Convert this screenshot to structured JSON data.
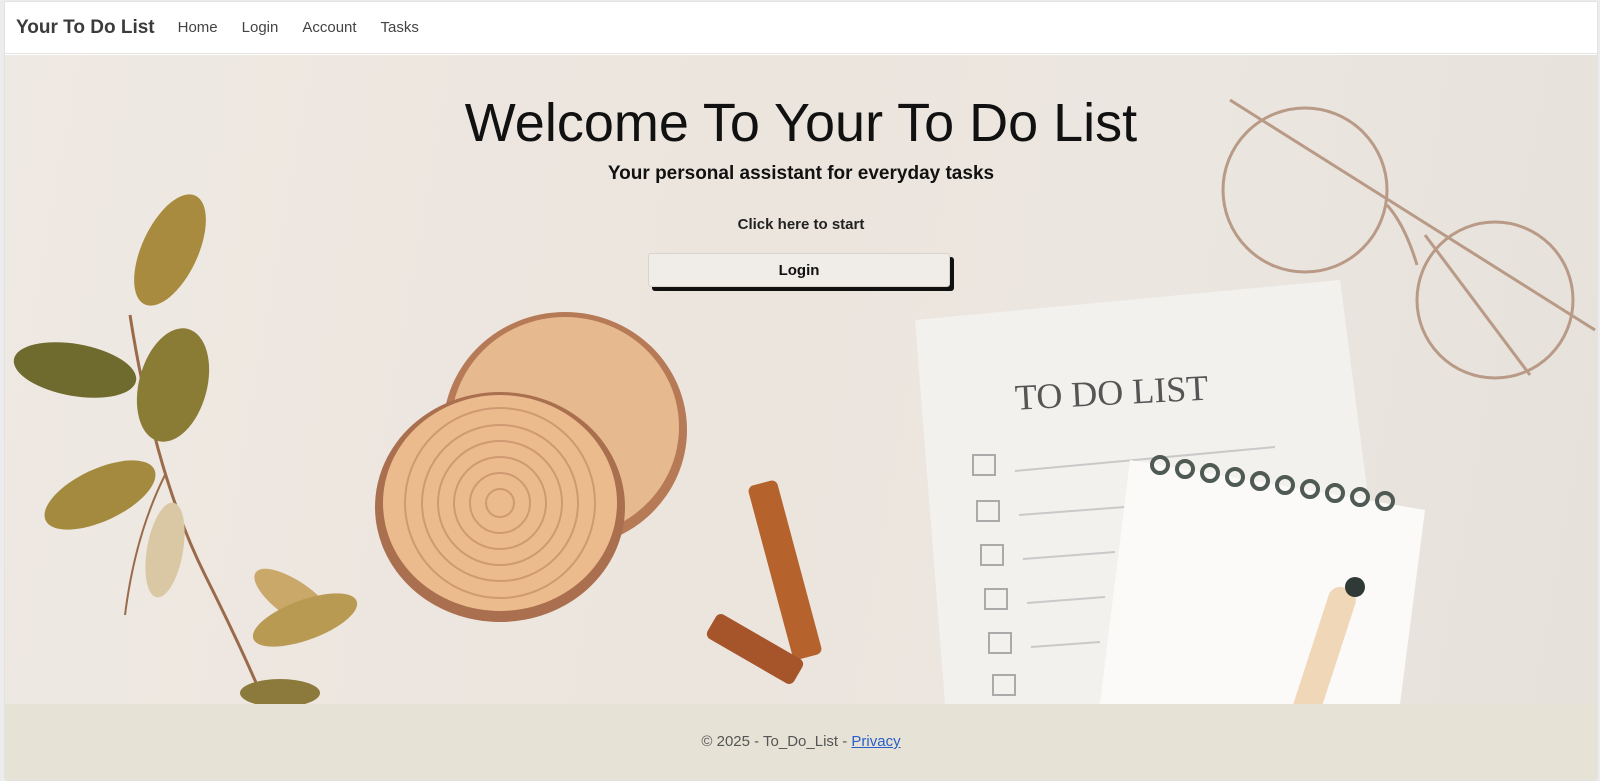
{
  "navbar": {
    "brand": "Your To Do List",
    "links": [
      "Home",
      "Login",
      "Account",
      "Tasks"
    ]
  },
  "hero": {
    "title": "Welcome To Your To Do List",
    "subtitle": "Your personal assistant for everyday tasks",
    "cta_text": "Click here to start",
    "login_button": "Login",
    "notepad_title": "TO DO LIST"
  },
  "footer": {
    "copyright": "© 2025 - To_Do_List - ",
    "privacy_link": "Privacy"
  },
  "colors": {
    "footer_bg": "#e6e3d6",
    "link": "#2a5fc8",
    "button_shadow": "#111111"
  }
}
